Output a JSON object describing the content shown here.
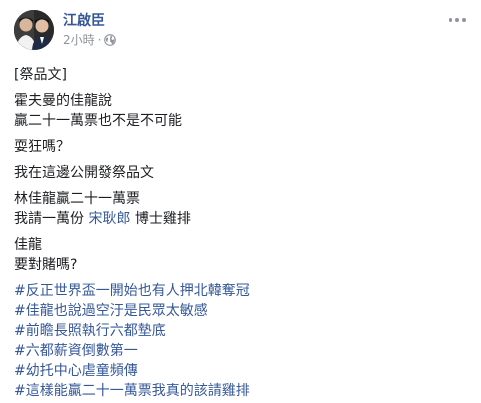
{
  "post": {
    "author": "江啟臣",
    "time": "2小時",
    "separator": "·",
    "icons": {
      "privacy": "globe-icon",
      "more": "more-options-icon"
    },
    "colors": {
      "link": "#365899",
      "text": "#1c1e21",
      "meta": "#90949c"
    },
    "body": {
      "tag_line": "[祭品文]",
      "p1_line1": "霍夫曼的佳龍說",
      "p1_line2": "贏二十一萬票也不是不可能",
      "p2": "耍狂嗎？",
      "p3": "我在這邊公開發祭品文",
      "p4_line1": "林佳龍贏二十一萬票",
      "p4_line2_prefix": "我請一萬份 ",
      "p4_line2_link": "宋耿郎",
      "p4_line2_suffix": " 博士雞排",
      "p5_line1": "佳龍",
      "p5_line2": "要對賭嗎?"
    },
    "hashtags": [
      "#反正世界盃一開始也有人押北韓奪冠",
      "#佳龍也說過空汙是民眾太敏感",
      "#前瞻長照執行六都墊底",
      "#六都薪資倒數第一",
      "#幼托中心虐童頻傳",
      "#這樣能贏二十一萬票我真的該請雞排"
    ]
  }
}
